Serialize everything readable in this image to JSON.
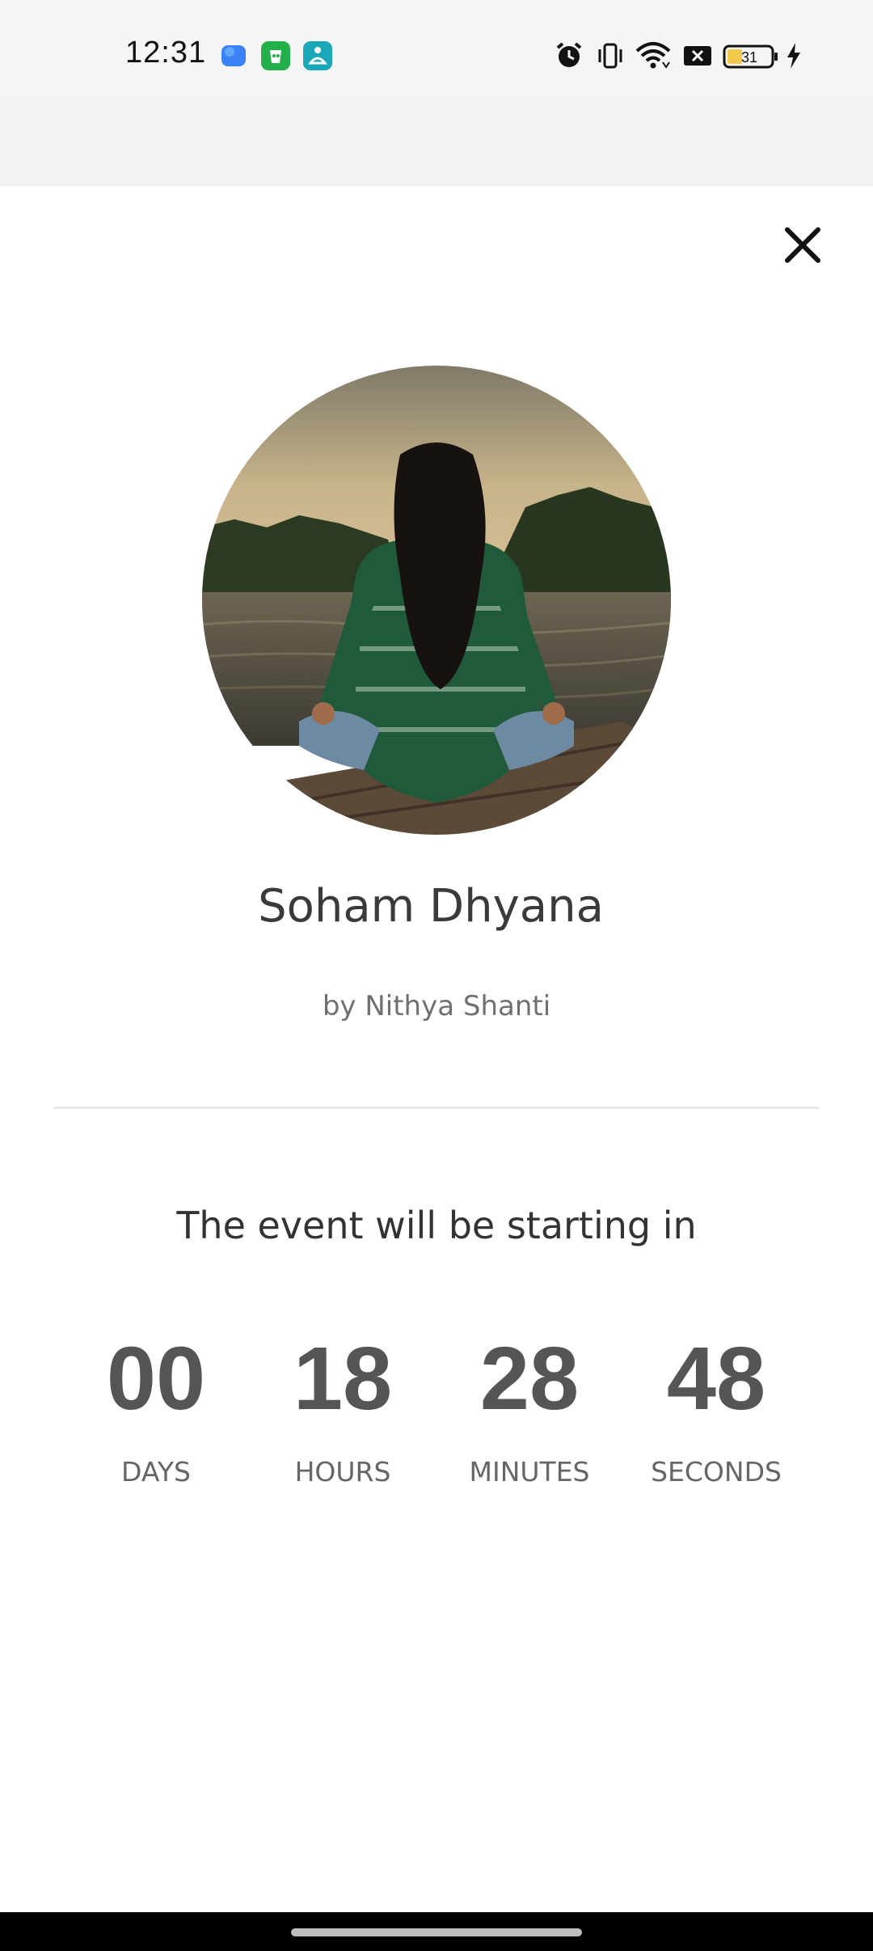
{
  "status_bar": {
    "time": "12:31",
    "battery": "31"
  },
  "event": {
    "title": "Soham Dhyana",
    "byline": "by Nithya Shanti",
    "countdown_intro": "The event will be starting in"
  },
  "countdown": [
    {
      "value": "00",
      "label": "DAYS"
    },
    {
      "value": "18",
      "label": "HOURS"
    },
    {
      "value": "28",
      "label": "MINUTES"
    },
    {
      "value": "48",
      "label": "SECONDS"
    }
  ],
  "icons": {
    "close": "close-icon",
    "alarm": "alarm-icon",
    "vibrate": "vibrate-icon",
    "wifi": "wifi-icon",
    "notification_x": "close-box-icon",
    "battery": "battery-icon",
    "charging": "charging-bolt-icon"
  },
  "colors": {
    "title": "#3a3a3a",
    "countdown_number": "#555555",
    "status_bar_bg": "#f5f5f5"
  }
}
